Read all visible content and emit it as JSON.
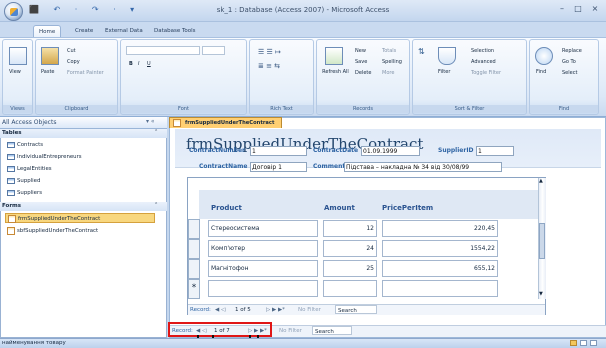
{
  "window": {
    "title": "sk_1 : Database (Access 2007) - Microsoft Access",
    "quick_access": "⬛ ↶ · ↷ · ▾",
    "minimize": "–",
    "maximize": "□",
    "close": "×"
  },
  "ribbon": {
    "tabs": [
      "Home",
      "Create",
      "External Data",
      "Database Tools"
    ],
    "groups": [
      "Views",
      "Clipboard",
      "Font",
      "Rich Text",
      "Records",
      "Sort & Filter",
      "Find"
    ],
    "views": {
      "view_label": "View"
    },
    "clipboard": {
      "paste_label": "Paste",
      "cut_label": "Cut",
      "copy_label": "Copy",
      "format_painter_label": "Format Painter"
    },
    "font": {
      "bold": "B",
      "italic": "I",
      "underline": "U",
      "font_value": "",
      "size_value": ""
    },
    "records": {
      "refresh_label": "Refresh All",
      "new_label": "New",
      "save_label": "Save",
      "delete_label": "Delete",
      "totals_label": "Totals",
      "spelling_label": "Spelling",
      "more_label": "More"
    },
    "sort_filter": {
      "filter_label": "Filter",
      "selection_label": "Selection",
      "advanced_label": "Advanced",
      "toggle_filter_label": "Toggle Filter"
    },
    "find": {
      "find_label": "Find",
      "replace_label": "Replace",
      "goto_label": "Go To",
      "select_label": "Select"
    }
  },
  "nav_pane": {
    "title": "All Access Objects",
    "sections": [
      {
        "label": "Tables",
        "items": [
          "Contracts",
          "IndividualEntrepreneurs",
          "LegalEntities",
          "Supplied",
          "Suppliers"
        ]
      },
      {
        "label": "Forms",
        "items": [
          "frmSuppliedUnderTheContract",
          "sbfSuppliedUnderTheContract"
        ]
      }
    ]
  },
  "document": {
    "tab_label": "frmSuppliedUnderTheContract",
    "form_title": "frmSuppliedUnderTheContract",
    "fields": {
      "contract_number": {
        "label": "ContractNumber",
        "value": "1"
      },
      "contract_date": {
        "label": "ContractDate",
        "value": "01.09.1999"
      },
      "supplier_id": {
        "label": "SupplierID",
        "value": "1"
      },
      "contract_name": {
        "label": "ContractName",
        "value": "Договір 1"
      },
      "comment": {
        "label": "Comment",
        "value": "Підстава – накладна № 34 від 30/08/99"
      }
    },
    "subform": {
      "columns": [
        "Product",
        "Amount",
        "PricePerItem"
      ],
      "rows": [
        {
          "product": "Стереосистема",
          "amount": "12",
          "price": "220,45"
        },
        {
          "product": "Комп'ютер",
          "amount": "24",
          "price": "1554,22"
        },
        {
          "product": "Магнітофон",
          "amount": "25",
          "price": "655,12"
        }
      ],
      "new_record_marker": "*",
      "navigator": {
        "record_label": "Record:",
        "current": "1 of 5",
        "filter_label": "No Filter",
        "search_label": "Search"
      }
    },
    "main_navigator": {
      "record_label": "Record:",
      "current": "1 of 7",
      "filter_label": "No Filter",
      "search_label": "Search"
    }
  },
  "status_bar": {
    "text": "найменування товару"
  },
  "colors": {
    "selected_object": "#f8d77f",
    "accent": "#2d63a3",
    "highlight": "#e01616"
  }
}
